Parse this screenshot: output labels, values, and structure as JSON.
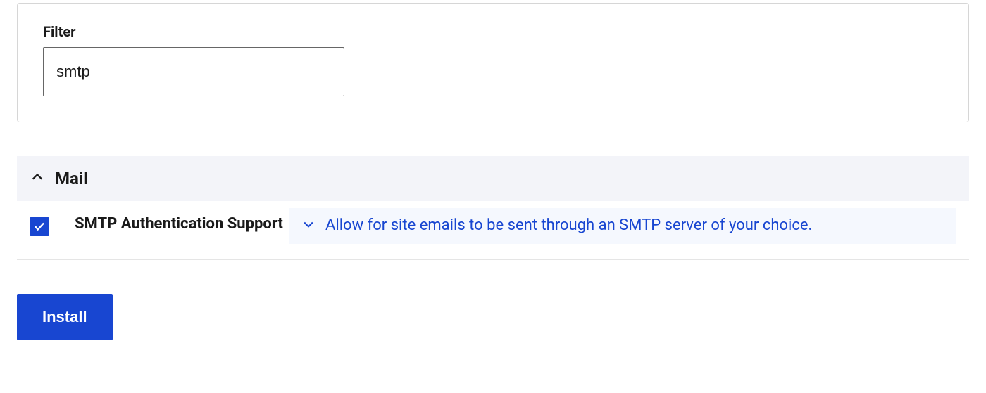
{
  "filter": {
    "label": "Filter",
    "value": "smtp"
  },
  "section": {
    "title": "Mail"
  },
  "item": {
    "name": "SMTP Authentication Support",
    "description": "Allow for site emails to be sent through an SMTP server of your choice.",
    "checked": true
  },
  "actions": {
    "install_label": "Install"
  },
  "colors": {
    "accent": "#1846d1",
    "panel_bg": "#f3f4f9",
    "desc_bg": "#f5f8fe"
  }
}
